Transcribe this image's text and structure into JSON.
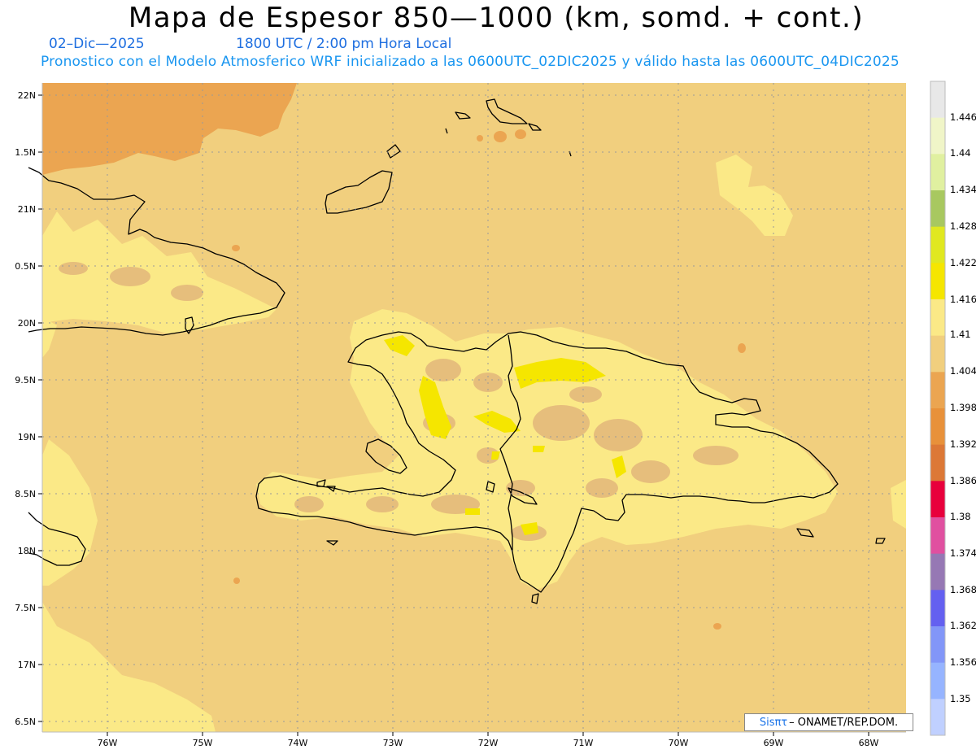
{
  "title": "Mapa de Espesor 850—1000 (km, somd. + cont.)",
  "date": "02–Dic—2025",
  "time": "1800 UTC / 2:00 pm Hora Local",
  "forecast_line": "Pronostico con el Modelo Atmosferico WRF inicializado a las 0600UTC_02DIC2025 y válido hasta las  0600UTC_04DIC2025",
  "credit": {
    "brand": "Sisπτ",
    "org": "– ONAMET/REP.DOM."
  },
  "axes": {
    "lat_labels": [
      "22N",
      "1.5N",
      "21N",
      "0.5N",
      "20N",
      "9.5N",
      "19N",
      "8.5N",
      "18N",
      "7.5N",
      "17N",
      "6.5N"
    ],
    "lon_labels": [
      "76W",
      "75W",
      "74W",
      "73W",
      "72W",
      "71W",
      "70W",
      "69W",
      "68W"
    ]
  },
  "colorbar": {
    "labels": [
      "1.446",
      "1.44",
      "1.434",
      "1.428",
      "1.422",
      "1.416",
      "1.41",
      "1.404",
      "1.398",
      "1.392",
      "1.386",
      "1.38",
      "1.374",
      "1.368",
      "1.362",
      "1.356",
      "1.35"
    ],
    "colors": [
      "#e8e8e8",
      "#f0f5c8",
      "#e0f0a0",
      "#a8c860",
      "#e0e820",
      "#f5e600",
      "#fbe987",
      "#f1cf7e",
      "#eba551",
      "#e8913a",
      "#dc7836",
      "#e8003c",
      "#e050a0",
      "#9678b4",
      "#6460f0",
      "#8296f8",
      "#96b4ff",
      "#c0d0ff"
    ]
  },
  "legend_colors": {
    "background": "#f1cf7e",
    "light": "#fbe987",
    "mid": "#e6be7c",
    "yellow": "#f5e600",
    "orange": "#eba551",
    "coast": "#000000",
    "grid": "#999999"
  }
}
